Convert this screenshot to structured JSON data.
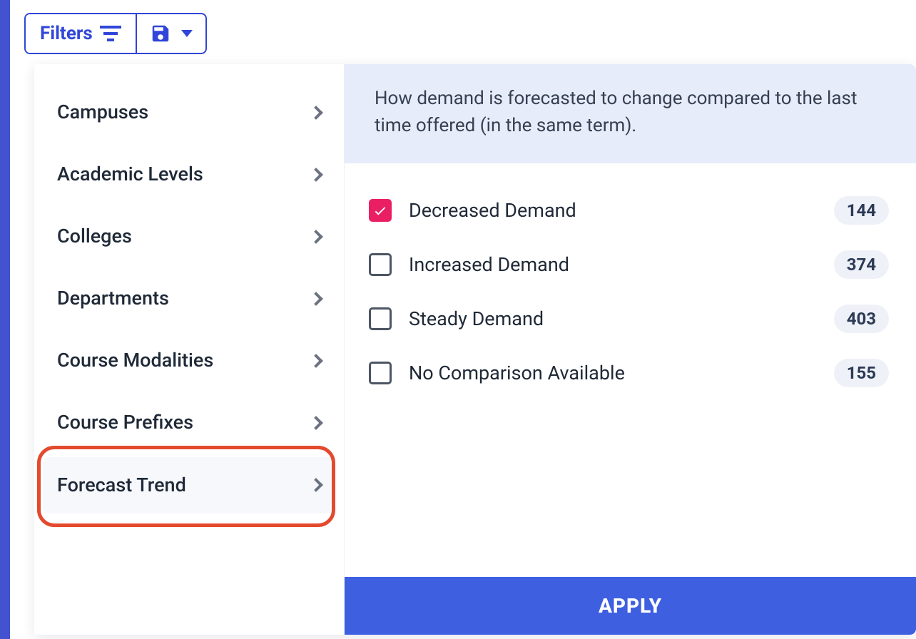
{
  "toolbar": {
    "filters_label": "Filters"
  },
  "categories": [
    {
      "label": "Campuses",
      "active": false
    },
    {
      "label": "Academic Levels",
      "active": false
    },
    {
      "label": "Colleges",
      "active": false
    },
    {
      "label": "Departments",
      "active": false
    },
    {
      "label": "Course Modalities",
      "active": false
    },
    {
      "label": "Course Prefixes",
      "active": false
    },
    {
      "label": "Forecast Trend",
      "active": true
    }
  ],
  "panel": {
    "description": "How demand is forecasted to change compared to the last time offered (in the same term).",
    "options": [
      {
        "label": "Decreased Demand",
        "count": "144",
        "checked": true
      },
      {
        "label": "Increased Demand",
        "count": "374",
        "checked": false
      },
      {
        "label": "Steady Demand",
        "count": "403",
        "checked": false
      },
      {
        "label": "No Comparison Available",
        "count": "155",
        "checked": false
      }
    ],
    "apply_label": "APPLY"
  }
}
